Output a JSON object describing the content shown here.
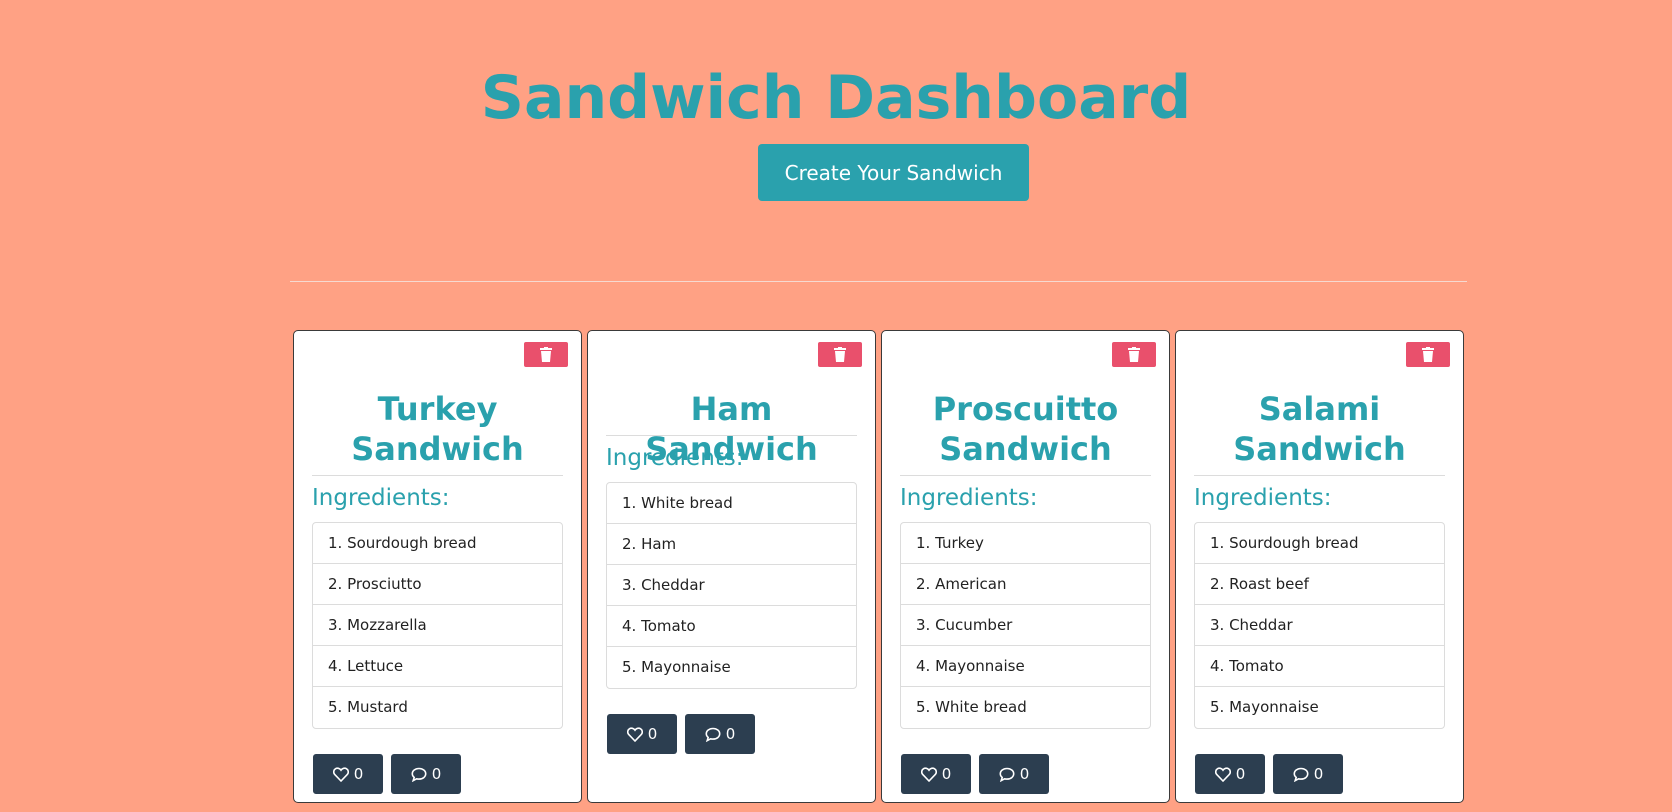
{
  "header": {
    "title": "Sandwich Dashboard",
    "create_button": "Create Your Sandwich"
  },
  "ingredients_label": "Ingredients:",
  "icons": {
    "delete": "trash-icon",
    "like": "heart-icon",
    "comment": "comment-icon"
  },
  "colors": {
    "background": "#ffa184",
    "accent": "#2aa1ad",
    "delete": "#e9506c",
    "action": "#2c3e50"
  },
  "cards": [
    {
      "title_line1": "Turkey",
      "title_line2": "Sandwich",
      "ingredients": [
        "1. Sourdough bread",
        "2. Prosciutto",
        "3. Mozzarella",
        "4. Lettuce",
        "5. Mustard"
      ],
      "likes": "0",
      "comments": "0"
    },
    {
      "title_line1": "Ham Sandwich",
      "ingredients": [
        "1. White bread",
        "2. Ham",
        "3. Cheddar",
        "4. Tomato",
        "5. Mayonnaise"
      ],
      "likes": "0",
      "comments": "0"
    },
    {
      "title_line1": "Proscuitto",
      "title_line2": "Sandwich",
      "ingredients": [
        "1. Turkey",
        "2. American",
        "3. Cucumber",
        "4. Mayonnaise",
        "5. White bread"
      ],
      "likes": "0",
      "comments": "0"
    },
    {
      "title_line1": "Salami",
      "title_line2": "Sandwich",
      "ingredients": [
        "1. Sourdough bread",
        "2. Roast beef",
        "3. Cheddar",
        "4. Tomato",
        "5. Mayonnaise"
      ],
      "likes": "0",
      "comments": "0"
    }
  ]
}
